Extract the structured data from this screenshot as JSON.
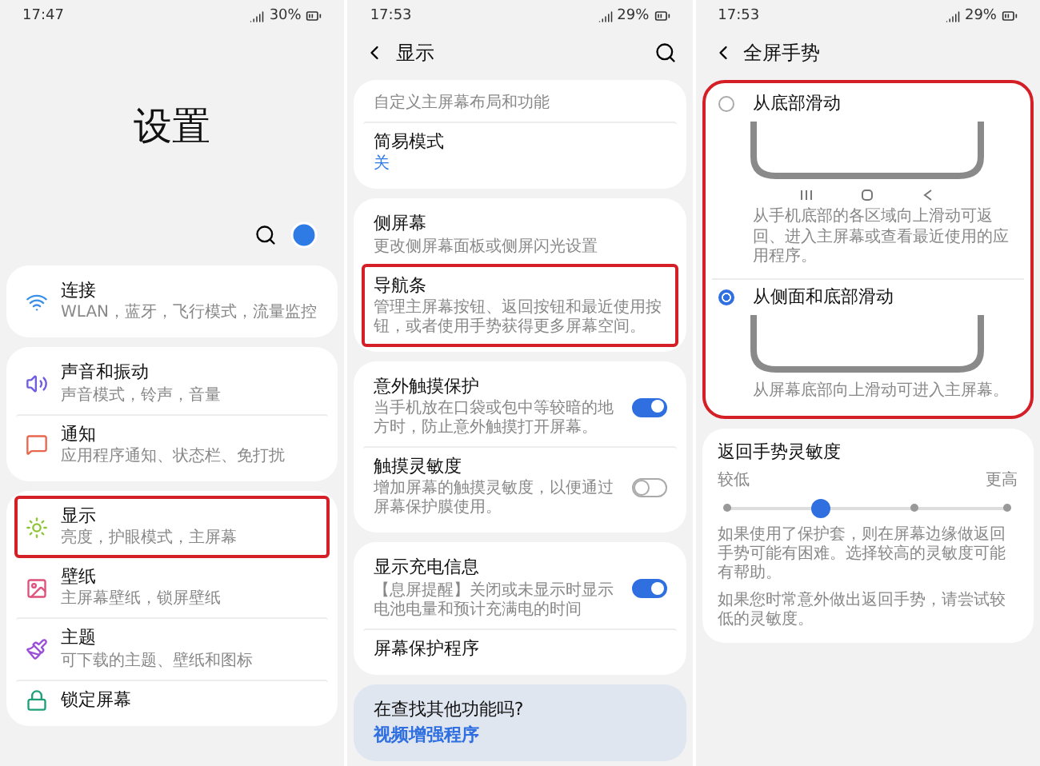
{
  "settings_screen": {
    "status_bar": {
      "time": "17:47",
      "battery": "30%"
    },
    "title": "设置",
    "groups": [
      {
        "items": [
          {
            "title": "连接",
            "subtitle": "WLAN，蓝牙，飞行模式，流量监控",
            "color": "#3b8fe8",
            "highlighted": false
          }
        ]
      },
      {
        "items": [
          {
            "title": "声音和振动",
            "subtitle": "声音模式，铃声，音量",
            "color": "#6f5ce0",
            "highlighted": false
          },
          {
            "title": "通知",
            "subtitle": "应用程序通知、状态栏、免打扰",
            "color": "#e8674f",
            "highlighted": false
          }
        ]
      },
      {
        "items": [
          {
            "title": "显示",
            "subtitle": "亮度，护眼模式，主屏幕",
            "color": "#8cc530",
            "highlighted": true
          },
          {
            "title": "壁纸",
            "subtitle": "主屏幕壁纸，锁屏壁纸",
            "color": "#e0507a",
            "highlighted": false
          },
          {
            "title": "主题",
            "subtitle": "可下载的主题、壁纸和图标",
            "color": "#9b4fd6",
            "highlighted": false
          },
          {
            "title": "锁定屏幕",
            "color": "#1f9e7a",
            "highlighted": false
          }
        ]
      }
    ]
  },
  "display_screen": {
    "status_bar": {
      "time": "17:53",
      "battery": "29%"
    },
    "title": "显示",
    "groups": [
      {
        "items": [
          {
            "subtitle": "自定义主屏幕布局和功能",
            "highlighted": false
          },
          {
            "title": "简易模式",
            "value": "关",
            "highlighted": false
          }
        ]
      },
      {
        "items": [
          {
            "title": "侧屏幕",
            "subtitle": "更改侧屏幕面板或侧屏闪光设置",
            "highlighted": false
          },
          {
            "title": "导航条",
            "subtitle": "管理主屏幕按钮、返回按钮和最近使用按钮，或者使用手势获得更多屏幕空间。",
            "highlighted": true
          }
        ]
      },
      {
        "items": [
          {
            "title": "意外触摸保护",
            "subtitle": "当手机放在口袋或包中等较暗的地方时，防止意外触摸打开屏幕。",
            "on": true,
            "highlighted": false
          },
          {
            "title": "触摸灵敏度",
            "subtitle": "增加屏幕的触摸灵敏度，以便通过屏幕保护膜使用。",
            "on": false,
            "highlighted": false
          }
        ]
      },
      {
        "items": [
          {
            "title": "显示充电信息",
            "subtitle": "【息屏提醒】关闭或未显示时显示电池电量和预计充满电的时间",
            "on": true,
            "highlighted": false
          },
          {
            "title": "屏幕保护程序",
            "highlighted": false
          }
        ]
      }
    ],
    "suggestions": {
      "title": "在查找其他功能吗?",
      "links": [
        "视频增强程序"
      ]
    }
  },
  "gesture_screen": {
    "status_bar": {
      "time": "17:53",
      "battery": "29%"
    },
    "title": "全屏手势",
    "options_highlighted": true,
    "options": [
      {
        "label": "从底部滑动",
        "selected": false,
        "nav_keys": true,
        "description": "从手机底部的各区域向上滑动可返回、进入主屏幕或查看最近使用的应用程序。"
      },
      {
        "label": "从侧面和底部滑动",
        "selected": true,
        "nav_keys": false,
        "description": "从屏幕底部向上滑动可进入主屏幕。"
      }
    ],
    "sensitivity": {
      "title": "返回手势灵敏度",
      "low_label": "较低",
      "high_label": "更高",
      "level": 0.3333,
      "notes": [
        "如果使用了保护套，则在屏幕边缘做返回手势可能有困难。选择较高的灵敏度可能有帮助。",
        "如果您时常意外做出返回手势，请尝试较低的灵敏度。"
      ]
    }
  }
}
